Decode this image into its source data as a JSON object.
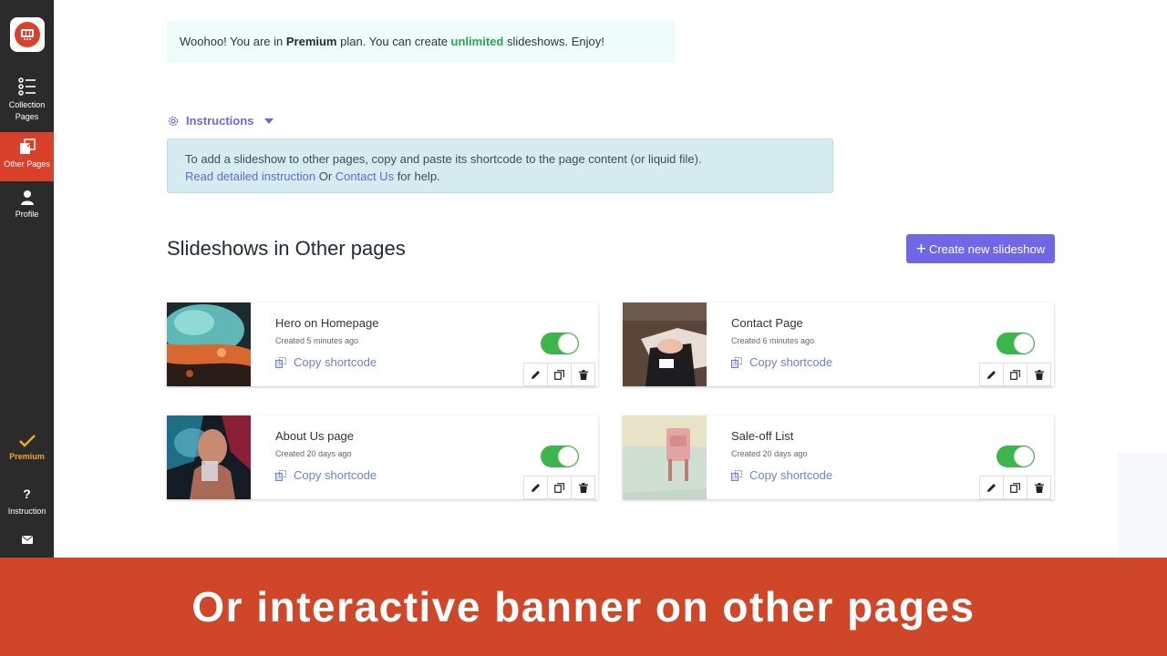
{
  "sidebar": {
    "items": [
      {
        "label_line1": "Collection",
        "label_line2": "Pages",
        "icon": "list-icon"
      },
      {
        "label": "Other Pages",
        "icon": "pages-icon"
      },
      {
        "label": "Profile",
        "icon": "user-icon"
      }
    ],
    "premium_label": "Premium",
    "instruction_label": "Instruction",
    "instruction_icon": "?"
  },
  "premium_note": {
    "prefix": "Woohoo! You are in ",
    "plan": "Premium",
    "middle": " plan. You can create ",
    "highlight": "unlimited",
    "suffix": " slideshows. Enjoy!"
  },
  "instructions": {
    "toggle_label": "Instructions",
    "text": "To add a slideshow to other pages, copy and paste its shortcode to the page content (or liquid file).",
    "link1": "Read detailed instruction",
    "or": " Or ",
    "link2": "Contact Us",
    "tail": " for help."
  },
  "section": {
    "title": "Slideshows in Other pages",
    "create_button": "Create new slideshow"
  },
  "slideshows": [
    {
      "name": "Hero on Homepage",
      "created": "Created 5 minutes ago",
      "copy": "Copy shortcode",
      "enabled": true
    },
    {
      "name": "Contact Page",
      "created": "Created 6 minutes ago",
      "copy": "Copy shortcode",
      "enabled": true
    },
    {
      "name": "About Us page",
      "created": "Created 20 days ago",
      "copy": "Copy shortcode",
      "enabled": true
    },
    {
      "name": "Sale-off List",
      "created": "Created 20 days ago",
      "copy": "Copy shortcode",
      "enabled": true
    }
  ],
  "banner": {
    "text": "Or interactive banner on other pages"
  },
  "colors": {
    "accent": "#7067e6",
    "brand": "#d9412a",
    "toggle_on": "#3cb54a",
    "premium": "#f0a531"
  }
}
